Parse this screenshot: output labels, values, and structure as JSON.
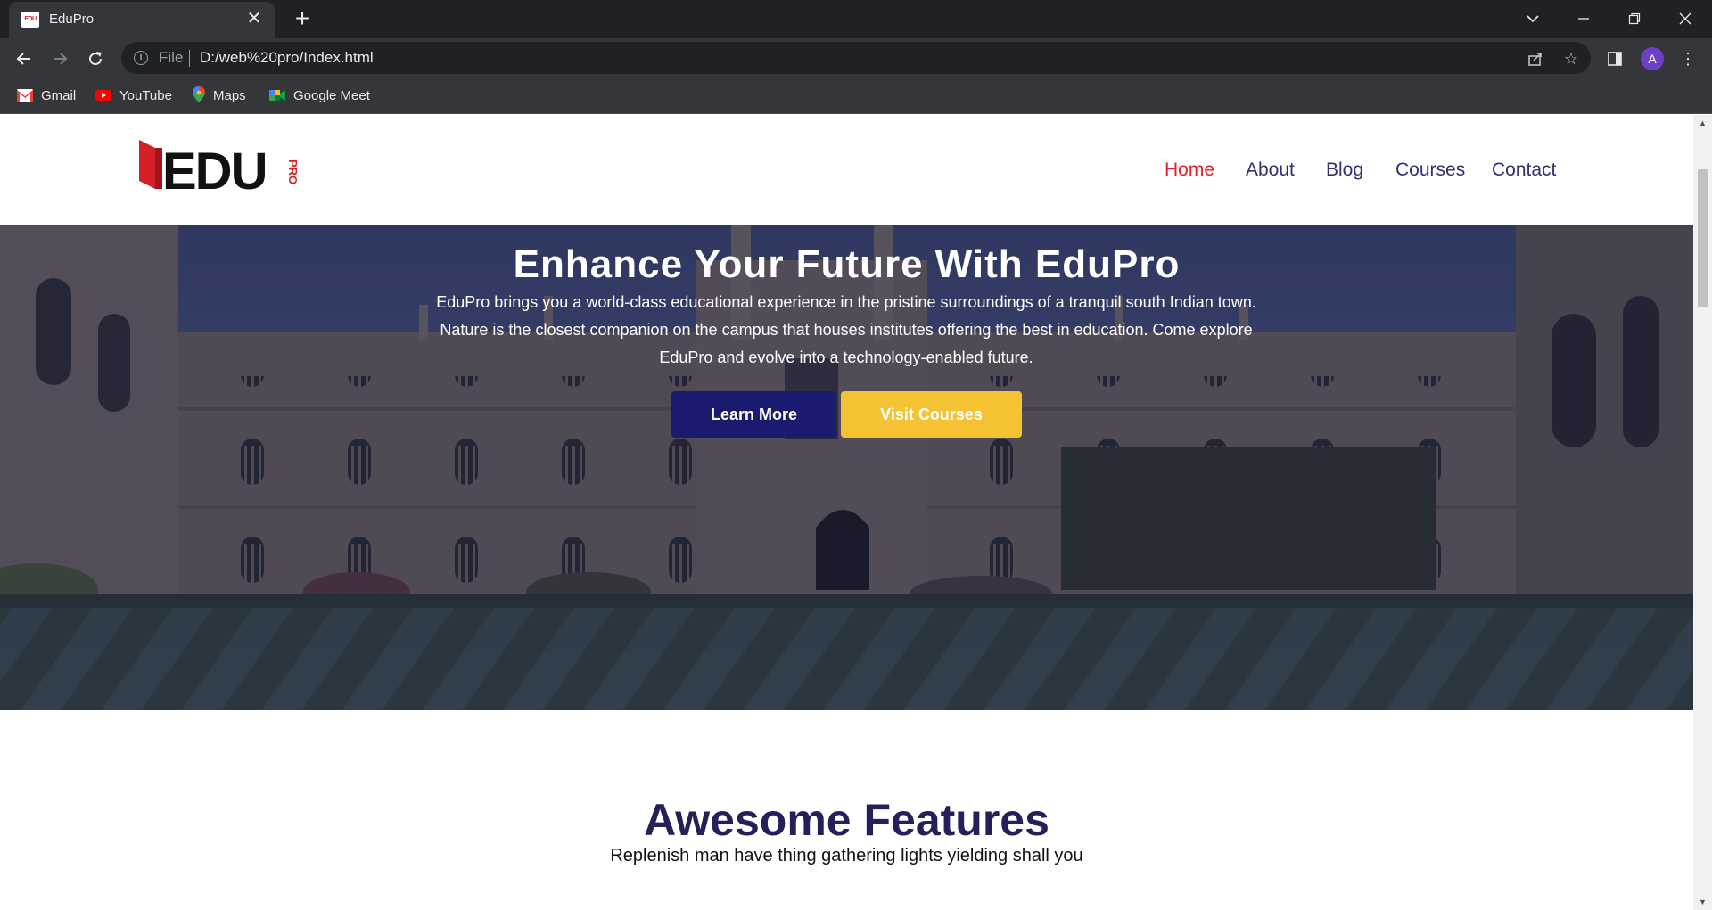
{
  "browser": {
    "tab_title": "EduPro",
    "tab_favicon_text": "EDU",
    "url_scheme": "File",
    "url": "D:/web%20pro/Index.html",
    "profile_initial": "A",
    "bookmarks": [
      {
        "label": "Gmail",
        "icon": "gmail-icon"
      },
      {
        "label": "YouTube",
        "icon": "youtube-icon"
      },
      {
        "label": "Maps",
        "icon": "maps-icon"
      },
      {
        "label": "Google Meet",
        "icon": "google-meet-icon"
      }
    ]
  },
  "site": {
    "logo_main": "EDU",
    "logo_side": "PRO",
    "nav": [
      {
        "label": "Home",
        "active": true
      },
      {
        "label": "About"
      },
      {
        "label": "Blog"
      },
      {
        "label": "Courses"
      },
      {
        "label": "Contact"
      }
    ],
    "hero": {
      "title": "Enhance Your Future With EduPro",
      "text_lines": [
        "EduPro brings you a world-class educational experience in the pristine surroundings of a tranquil south Indian town.",
        "Nature is the closest companion on the campus that houses institutes offering the best in education. Come explore",
        "EduPro and evolve into a technology-enabled future."
      ],
      "learn_more": "Learn More",
      "visit_courses": "Visit Courses"
    },
    "features": {
      "title": "Awesome Features",
      "subtitle": "Replenish man have thing gathering lights yielding shall you"
    }
  },
  "colors": {
    "accent_red": "#e41e26",
    "nav_blue": "#2f3170",
    "button_navy": "#1a1a6e",
    "button_yellow": "#f4c233"
  }
}
